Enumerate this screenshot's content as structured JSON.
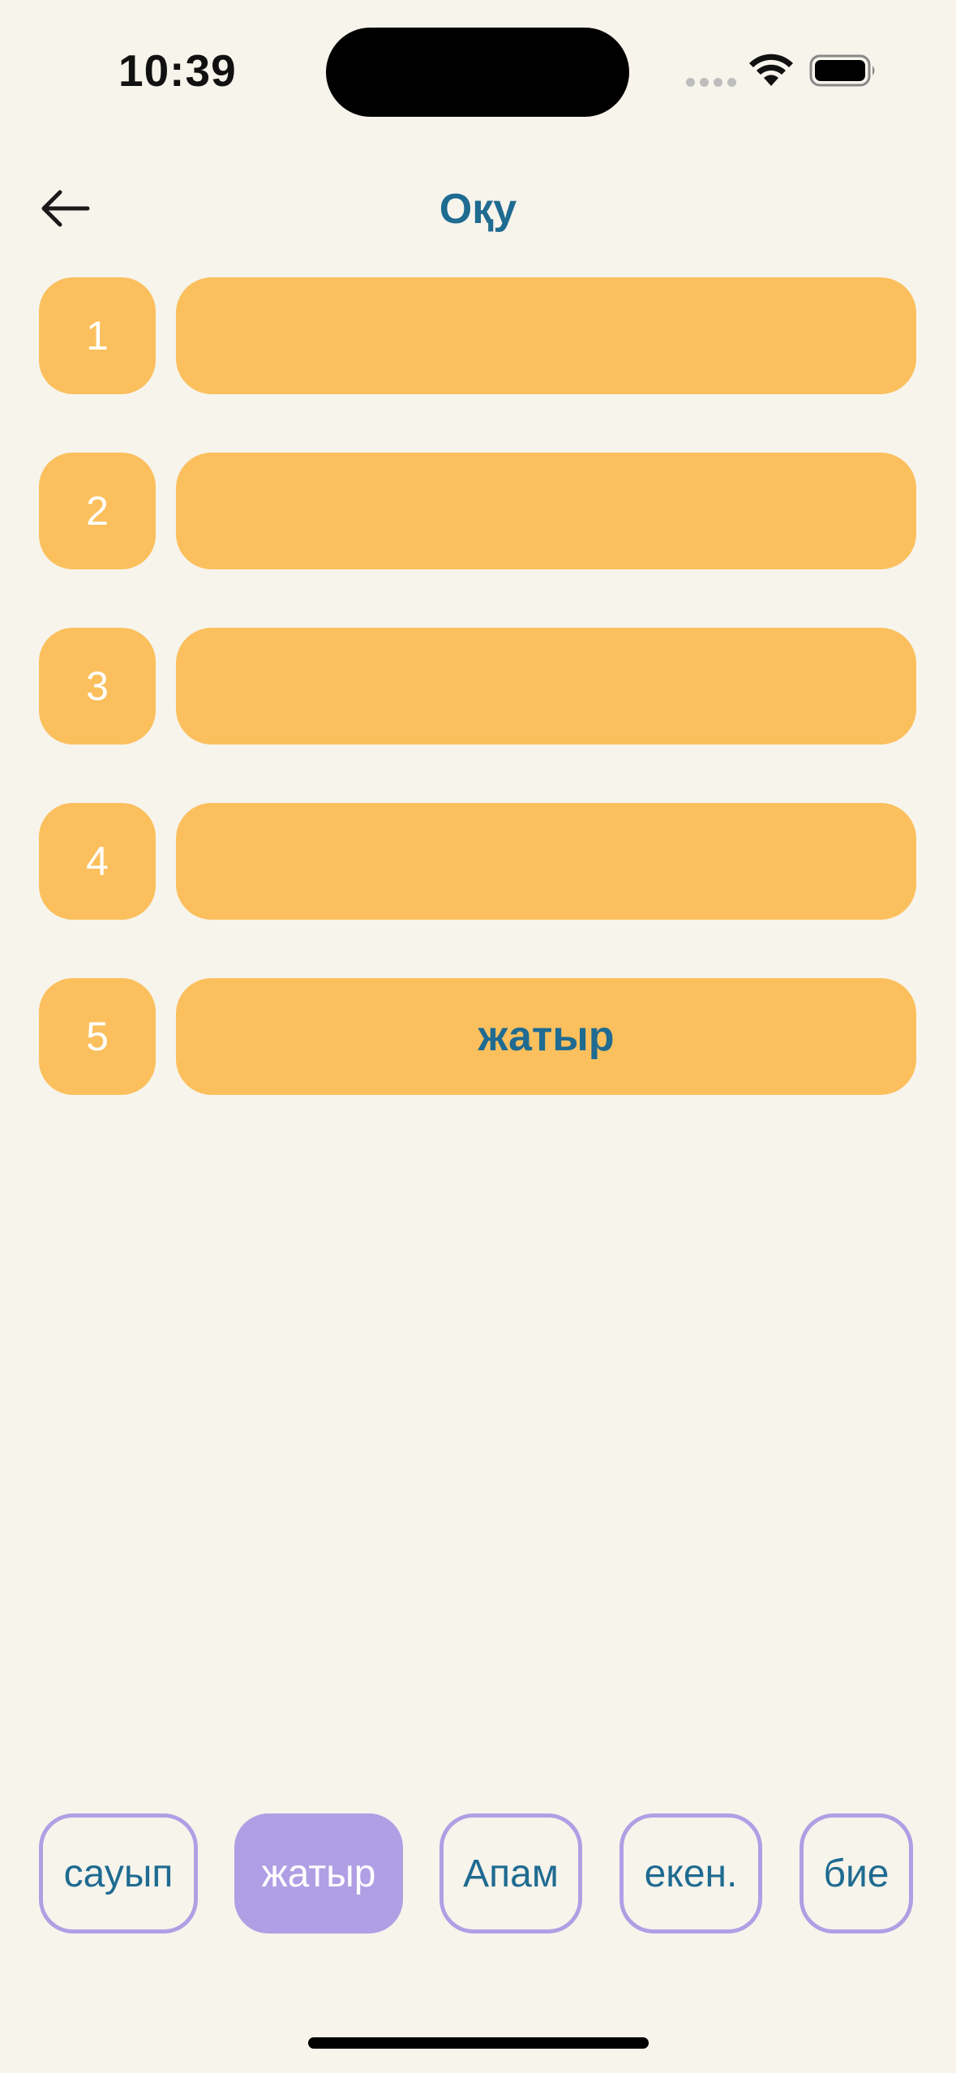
{
  "status_bar": {
    "time": "10:39"
  },
  "header": {
    "back_icon": "arrow-left-icon",
    "title": "Оқу"
  },
  "slots": [
    {
      "number": "1",
      "word": ""
    },
    {
      "number": "2",
      "word": ""
    },
    {
      "number": "3",
      "word": ""
    },
    {
      "number": "4",
      "word": ""
    },
    {
      "number": "5",
      "word": "жатыр"
    }
  ],
  "word_bank": [
    {
      "word": "сауып",
      "used": false
    },
    {
      "word": "жатыр",
      "used": true
    },
    {
      "word": "Апам",
      "used": false
    },
    {
      "word": "екен.",
      "used": false
    },
    {
      "word": "бие",
      "used": false
    }
  ],
  "colors": {
    "background": "#F7F4EC",
    "slot": "#FBC05D",
    "accent_text": "#1F6B91",
    "chip_border": "#B09FE4"
  }
}
